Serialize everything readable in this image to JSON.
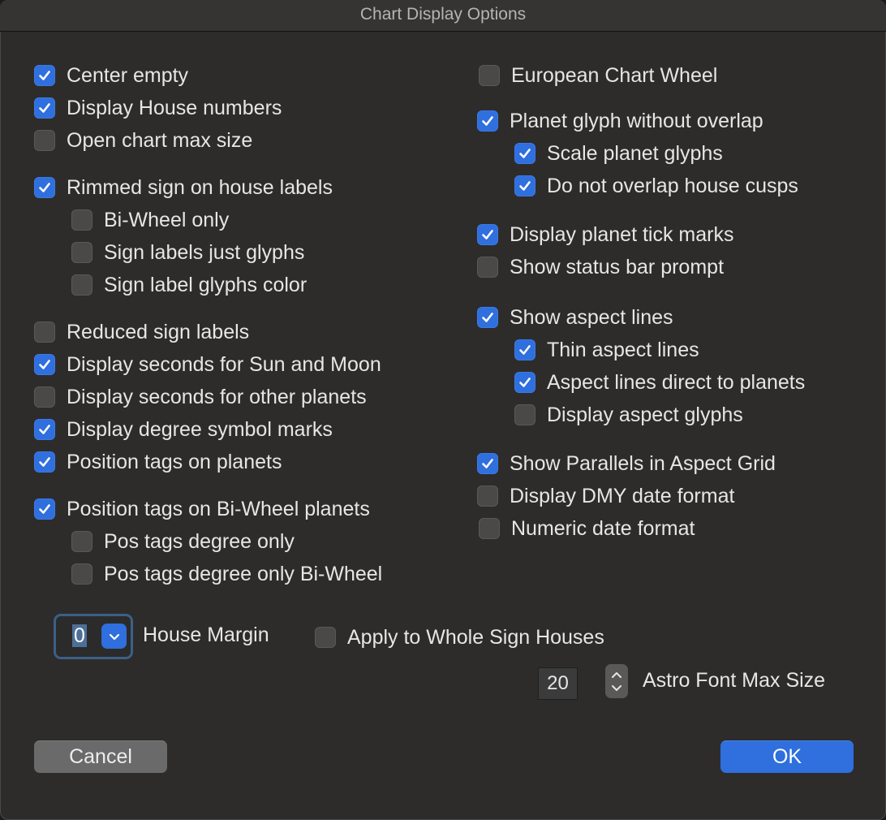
{
  "window": {
    "title": "Chart Display Options"
  },
  "options": {
    "center_empty": {
      "label": "Center empty",
      "checked": true
    },
    "display_house_numbers": {
      "label": "Display House numbers",
      "checked": true
    },
    "open_chart_max_size": {
      "label": "Open chart max size",
      "checked": false
    },
    "rimmed_sign": {
      "label": "Rimmed sign on house labels",
      "checked": true
    },
    "bi_wheel_only": {
      "label": "Bi-Wheel only",
      "checked": false
    },
    "sign_labels_just_glyphs": {
      "label": "Sign labels just glyphs",
      "checked": false
    },
    "sign_label_glyphs_color": {
      "label": "Sign label glyphs color",
      "checked": false
    },
    "reduced_sign_labels": {
      "label": "Reduced sign labels",
      "checked": false
    },
    "seconds_sun_moon": {
      "label": "Display seconds for Sun and Moon",
      "checked": true
    },
    "seconds_other_planets": {
      "label": "Display seconds for other planets",
      "checked": false
    },
    "degree_symbol_marks": {
      "label": "Display degree symbol marks",
      "checked": true
    },
    "position_tags_planets": {
      "label": "Position tags on planets",
      "checked": true
    },
    "position_tags_biwheel": {
      "label": "Position tags on Bi-Wheel planets",
      "checked": true
    },
    "pos_tags_degree_only": {
      "label": "Pos tags degree only",
      "checked": false
    },
    "pos_tags_degree_only_biwheel": {
      "label": "Pos tags degree only Bi-Wheel",
      "checked": false
    },
    "european_chart_wheel": {
      "label": "European Chart Wheel",
      "checked": false
    },
    "planet_glyph_no_overlap": {
      "label": "Planet glyph without overlap",
      "checked": true
    },
    "scale_planet_glyphs": {
      "label": "Scale planet glyphs",
      "checked": true
    },
    "no_overlap_house_cusps": {
      "label": "Do not overlap house cusps",
      "checked": true
    },
    "planet_tick_marks": {
      "label": "Display planet tick marks",
      "checked": true
    },
    "status_bar_prompt": {
      "label": "Show status bar prompt",
      "checked": false
    },
    "show_aspect_lines": {
      "label": "Show aspect lines",
      "checked": true
    },
    "thin_aspect_lines": {
      "label": "Thin aspect lines",
      "checked": true
    },
    "aspect_lines_direct": {
      "label": "Aspect lines direct to planets",
      "checked": true
    },
    "display_aspect_glyphs": {
      "label": "Display aspect glyphs",
      "checked": false
    },
    "parallels_aspect_grid": {
      "label": "Show Parallels in Aspect Grid",
      "checked": true
    },
    "dmy_date_format": {
      "label": "Display DMY date format",
      "checked": false
    },
    "numeric_date_format": {
      "label": "Numeric date format",
      "checked": false
    },
    "whole_sign_houses": {
      "label": "Apply to Whole Sign Houses",
      "checked": false
    }
  },
  "house_margin": {
    "value": "0",
    "label": "House Margin"
  },
  "astro_font": {
    "value": "20",
    "label": "Astro Font Max Size"
  },
  "buttons": {
    "cancel": "Cancel",
    "ok": "OK"
  },
  "colors": {
    "accent": "#2f6fde",
    "window_bg": "#2d2c2b",
    "unchecked_box": "#4a4948"
  }
}
